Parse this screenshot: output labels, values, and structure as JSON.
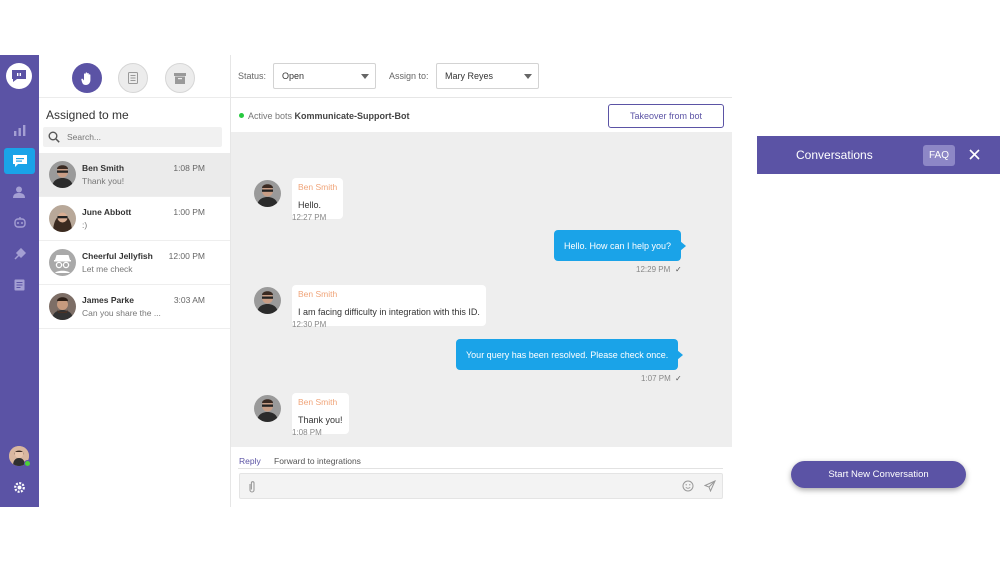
{
  "list": {
    "title": "Assigned to me",
    "search_placeholder": "Search...",
    "conversations": [
      {
        "name": "Ben Smith",
        "preview": "Thank you!",
        "time": "1:08 PM"
      },
      {
        "name": "June Abbott",
        "preview": ":)",
        "time": "1:00 PM"
      },
      {
        "name": "Cheerful Jellyfish",
        "preview": "Let me check",
        "time": "12:00 PM"
      },
      {
        "name": "James Parke",
        "preview": "Can you share the ...",
        "time": "3:03 AM"
      }
    ]
  },
  "toolbar": {
    "status_label": "Status:",
    "status_value": "Open",
    "assign_label": "Assign to:",
    "assign_value": "Mary Reyes"
  },
  "botbar": {
    "active_label": "Active bots",
    "bot_name": "Kommunicate-Support-Bot",
    "takeover_label": "Takeover from bot"
  },
  "messages": [
    {
      "from": "Ben Smith",
      "text": "Hello.",
      "time": "12:27 PM"
    },
    {
      "text": "Hello. How can I help you?",
      "time": "12:29 PM",
      "check": "✓"
    },
    {
      "from": "Ben Smith",
      "text": "I am facing difficulty in integration with this ID.",
      "time": "12:30 PM"
    },
    {
      "text": "Your query has been resolved. Please check once.",
      "time": "1:07 PM",
      "check": "✓"
    },
    {
      "from": "Ben Smith",
      "text": "Thank you!",
      "time": "1:08 PM"
    }
  ],
  "reply": {
    "tab_reply": "Reply",
    "tab_forward": "Forward to integrations"
  },
  "widget": {
    "title": "Conversations",
    "faq": "FAQ",
    "start_label": "Start New Conversation"
  },
  "colors": {
    "brand": "#5b53a5",
    "accent": "#1aa3e8",
    "sender_name": "#f0a479",
    "online": "#4cd137"
  }
}
